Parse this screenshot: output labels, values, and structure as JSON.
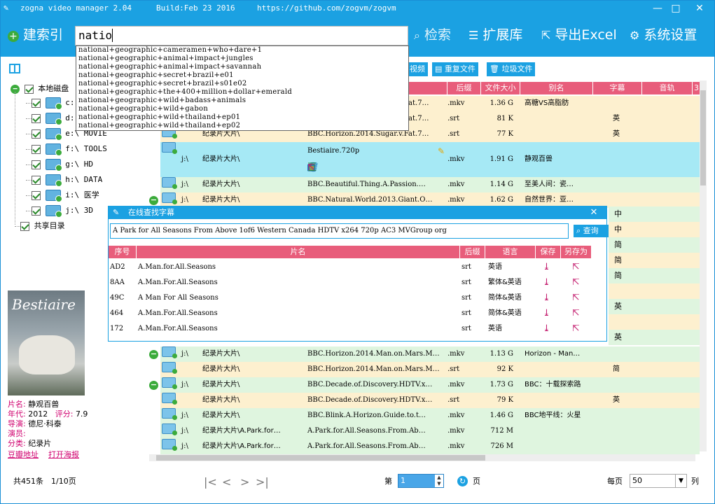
{
  "window": {
    "app_name": "zogna video manager 2.04",
    "build": "Build:Feb 23 2016",
    "url": "https://github.com/zogvm/zogvm",
    "minimize": "—",
    "maximize": "□",
    "close": "✕"
  },
  "toolbar": {
    "index_label": "建索引",
    "search_value": "natio",
    "search_label": "检索",
    "ext_label": "扩展库",
    "export_label": "导出Excel",
    "settings_label": "系统设置"
  },
  "suggestions": [
    "national+geographic+cameramen+who+dare+1",
    "national+geographic+animal+impact+jungles",
    "national+geographic+animal+impact+savannah",
    "national+geographic+secret+brazil+e01",
    "national+geographic+secret+brazil+s01e02",
    "national+geographic+the+400+million+dollar+emerald",
    "national+geographic+wild+badass+animals",
    "national+geographic+wild+gabon",
    "national+geographic+wild+thailand+ep01",
    "national+geographic+wild+thailand+ep02"
  ],
  "tree": {
    "local_root": "本地磁盘",
    "drives": [
      "c:",
      "d:",
      "e:\\ MOVIE",
      "f:\\ TOOLS",
      "g:\\ HD",
      "h:\\ DATA",
      "i:\\ 医学",
      "j:\\ 3D"
    ],
    "shared": "共享目录"
  },
  "filter_buttons": {
    "video": "视频",
    "duplicate": "重复文件",
    "junk": "垃圾文件"
  },
  "columns": {
    "ext": "后缀",
    "size": "文件大小",
    "alias": "别名",
    "subtitle": "字幕",
    "audio": "音轨",
    "more": "3"
  },
  "rows": [
    {
      "drive": "",
      "path": "",
      "name": "BBC.Horizon.2014.Sugar.v.Fat.7…",
      "ext": ".mkv",
      "size": "1.36 G",
      "alias": "高糖VS高脂肪",
      "sub": ""
    },
    {
      "drive": "",
      "path": "",
      "name": "BBC.Horizon.2014.Sugar.v.Fat.7…",
      "ext": ".srt",
      "size": "81 K",
      "alias": "",
      "sub": "英"
    },
    {
      "drive": "",
      "path": "纪录片大片\\",
      "name": "BBC.Horizon.2014.Sugar.v.Fat.7…",
      "ext": ".srt",
      "size": "77 K",
      "alias": "",
      "sub": "英"
    },
    {
      "drive": "j:\\",
      "path": "纪录片大片\\",
      "name": "Bestiaire.720p",
      "ext": ".mkv",
      "size": "1.91 G",
      "alias": "静观百兽",
      "sub": ""
    },
    {
      "drive": "j:\\",
      "path": "纪录片大片\\",
      "name": "BBC.Beautiful.Thing.A.Passion.…",
      "ext": ".mkv",
      "size": "1.14 G",
      "alias": "至美人间：瓷…",
      "sub": ""
    },
    {
      "drive": "j:\\",
      "path": "纪录片大片\\",
      "name": "BBC.Natural.World.2013.Giant.O…",
      "ext": ".mkv",
      "size": "1.62 G",
      "alias": "自然世界：亚…",
      "sub": ""
    },
    {
      "drive": "j:\\",
      "path": "纪录片大片\\",
      "name": "BBC.Horizon.2014.Man.on.Mars.M…",
      "ext": ".mkv",
      "size": "1.13 G",
      "alias": "Horizon - Man…",
      "sub": ""
    },
    {
      "drive": "",
      "path": "纪录片大片\\",
      "name": "BBC.Horizon.2014.Man.on.Mars.M…",
      "ext": ".srt",
      "size": "92 K",
      "alias": "",
      "sub": "简"
    },
    {
      "drive": "j:\\",
      "path": "纪录片大片\\",
      "name": "BBC.Decade.of.Discovery.HDTV.x…",
      "ext": ".mkv",
      "size": "1.73 G",
      "alias": "BBC：十载探索路",
      "sub": ""
    },
    {
      "drive": "",
      "path": "纪录片大片\\",
      "name": "BBC.Decade.of.Discovery.HDTV.x…",
      "ext": ".srt",
      "size": "79 K",
      "alias": "",
      "sub": "英"
    },
    {
      "drive": "j:\\",
      "path": "纪录片大片\\",
      "name": "BBC.Blink.A.Horizon.Guide.to.t…",
      "ext": ".mkv",
      "size": "1.46 G",
      "alias": "BBC地平线：火星",
      "sub": ""
    },
    {
      "drive": "j:\\",
      "path": "纪录片大片\\A.Park.for…",
      "name": "A.Park.for.All.Seasons.From.Ab…",
      "ext": ".mkv",
      "size": "712 M",
      "alias": "",
      "sub": ""
    },
    {
      "drive": "j:\\",
      "path": "纪录片大片\\A.Park.for…",
      "name": "A.Park.for.All.Seasons.From.Ab…",
      "ext": ".mkv",
      "size": "726 M",
      "alias": "",
      "sub": ""
    }
  ],
  "hidden_subs": [
    "中",
    "中",
    "简",
    "简",
    "简",
    "",
    "英",
    "",
    "英"
  ],
  "poster": {
    "title": "Bestiaire"
  },
  "info": {
    "name_k": "片名:",
    "name_v": "静观百兽",
    "year_k": "年代:",
    "year_v": "2012",
    "score_k": "评分:",
    "score_v": "7.9",
    "dir_k": "导演:",
    "dir_v": "德尼·科泰",
    "actor_k": "演员:",
    "actor_v": "",
    "cat_k": "分类:",
    "cat_v": "纪录片",
    "douban": "豆瓣地址",
    "open_poster": "打开海报"
  },
  "dialog": {
    "title": "在线查找字幕",
    "query": "A Park for All Seasons From Above 1of6 Western Canada HDTV x264 720p AC3 MVGroup org",
    "search_btn": "查询",
    "close": "✕",
    "headers": {
      "id": "序号",
      "name": "片名",
      "ext": "后缀",
      "lang": "语言",
      "save": "保存",
      "save_as": "另存为"
    },
    "rows": [
      {
        "id": "AD2",
        "name": "A.Man.for.All.Seasons",
        "ext": "srt",
        "lang": "英语"
      },
      {
        "id": "8AA",
        "name": "A.Man.For.All.Seasons",
        "ext": "srt",
        "lang": "繁体&英语"
      },
      {
        "id": "49C",
        "name": "A Man For All Seasons",
        "ext": "srt",
        "lang": "简体&英语"
      },
      {
        "id": "464",
        "name": "A.Man.For.All.Seasons",
        "ext": "srt",
        "lang": "简体&英语"
      },
      {
        "id": "172",
        "name": "A.Man.For.All.Seasons",
        "ext": "srt",
        "lang": "英语"
      }
    ]
  },
  "status": {
    "total": "共451条",
    "pages": "1/10页",
    "page_prefix": "第",
    "page_value": "1",
    "page_suffix": "页",
    "per_page_label": "每页",
    "per_page_value": "50",
    "per_page_suffix": "列"
  },
  "colors": {
    "accent": "#1ba1e2",
    "header": "#e85d7b",
    "row_green": "#dff5df",
    "row_yellow": "#fdf0cf",
    "row_selected": "#a6e9f5",
    "pink": "#d0006f"
  }
}
